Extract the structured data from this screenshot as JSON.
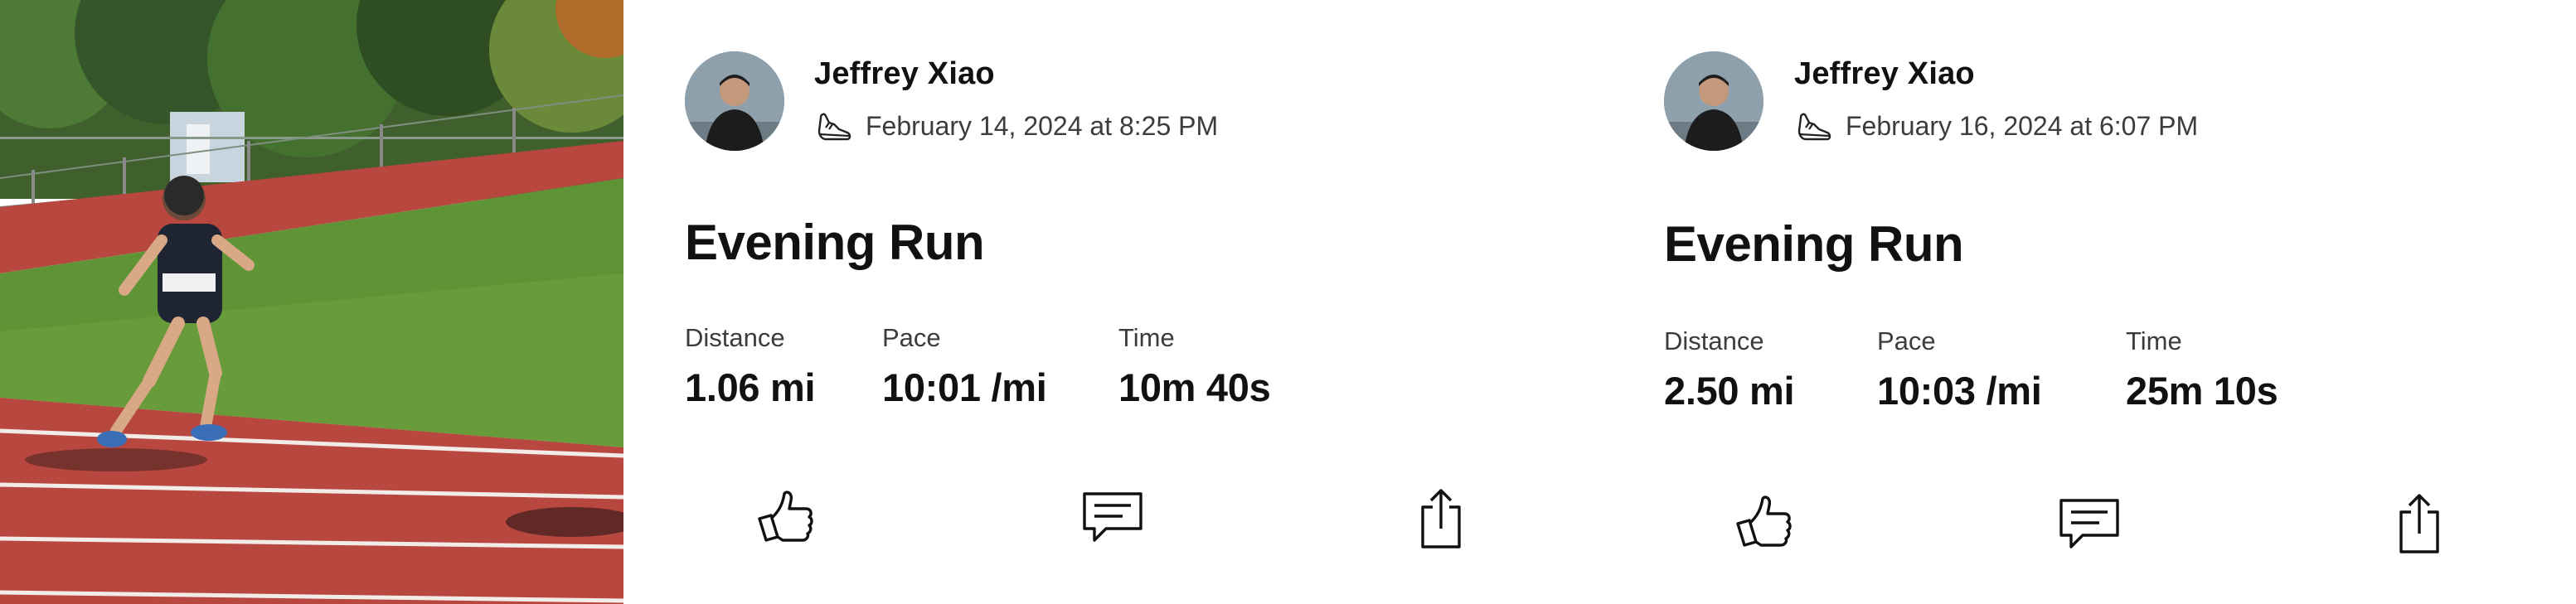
{
  "feed": {
    "activities": [
      {
        "athlete_name": "Jeffrey Xiao",
        "sport_icon": "running-shoe-icon",
        "date": "February 14, 2024 at 8:25 PM",
        "title": "Evening Run",
        "stats": [
          {
            "label": "Distance",
            "value": "1.06 mi"
          },
          {
            "label": "Pace",
            "value": "10:01 /mi"
          },
          {
            "label": "Time",
            "value": "10m 40s"
          }
        ],
        "actions": [
          "thumbs-up-icon",
          "comment-icon",
          "share-icon"
        ]
      },
      {
        "athlete_name": "Jeffrey Xiao",
        "sport_icon": "running-shoe-icon",
        "date": "February 16, 2024 at 6:07 PM",
        "title": "Evening Run",
        "stats": [
          {
            "label": "Distance",
            "value": "2.50 mi"
          },
          {
            "label": "Pace",
            "value": "10:03 /mi"
          },
          {
            "label": "Time",
            "value": "25m 10s"
          }
        ],
        "actions": [
          "thumbs-up-icon",
          "comment-icon",
          "share-icon"
        ]
      }
    ]
  },
  "colors": {
    "text": "#111111",
    "secondary_text": "#3c3c3c",
    "track": "#b8473f",
    "grass": "#5f9436"
  }
}
